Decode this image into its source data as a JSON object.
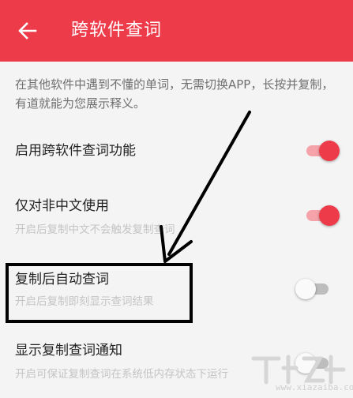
{
  "header": {
    "title": "跨软件查词"
  },
  "intro": "在其他软件中遇到不懂的单词，无需切换APP，长按并复制，有道就能为您展示释义。",
  "settings": [
    {
      "title": "启用跨软件查词功能",
      "subtitle": "",
      "enabled": true
    },
    {
      "title": "仅对非中文使用",
      "subtitle": "开启后复制中文不会触发复制查词",
      "enabled": true
    },
    {
      "title": "复制后自动查词",
      "subtitle": "开启后复制即刻显示查词结果",
      "enabled": false
    },
    {
      "title": "显示复制查词通知",
      "subtitle": "开启可保证复制查词在系统低内存状态下运行",
      "enabled": false
    }
  ],
  "watermark": {
    "text": "www.xiazaiba.com"
  },
  "colors": {
    "accent": "#ed3b4a",
    "background": "#f4f4f4"
  }
}
